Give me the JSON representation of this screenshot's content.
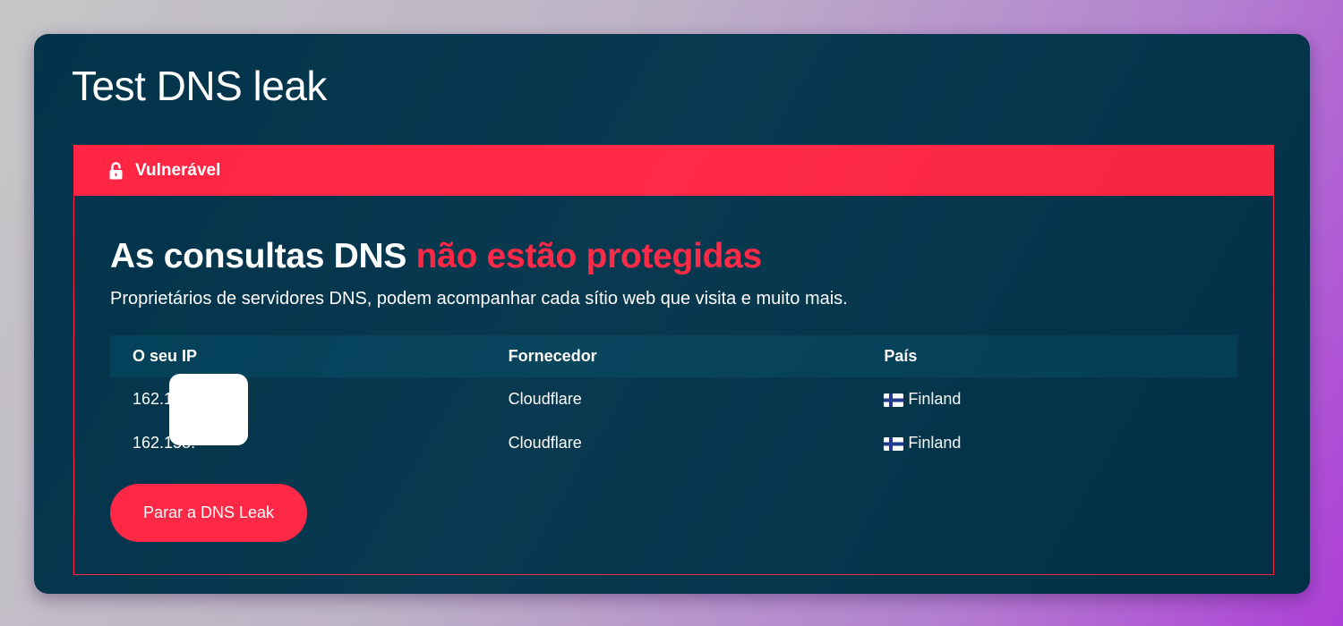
{
  "page": {
    "title": "Test DNS leak"
  },
  "status": {
    "label": "Vulnerável",
    "icon": "unlocked-padlock-icon",
    "color": "#ff2442"
  },
  "result": {
    "headline_main": "As consultas DNS ",
    "headline_accent": "não estão protegidas",
    "description": "Proprietários de servidores DNS, podem acompanhar cada sítio web que visita e muito mais."
  },
  "table": {
    "headers": [
      "O seu IP",
      "Fornecedor",
      "País"
    ],
    "rows": [
      {
        "ip": "162.158.",
        "provider": "Cloudflare",
        "country": "Finland",
        "flag": "finland-flag-icon"
      },
      {
        "ip": "162.158.",
        "provider": "Cloudflare",
        "country": "Finland",
        "flag": "finland-flag-icon"
      }
    ]
  },
  "actions": {
    "stop_label": "Parar a DNS Leak"
  },
  "colors": {
    "card_background": "#01334a",
    "table_header_background": "#013f58",
    "accent": "#ff2442"
  }
}
